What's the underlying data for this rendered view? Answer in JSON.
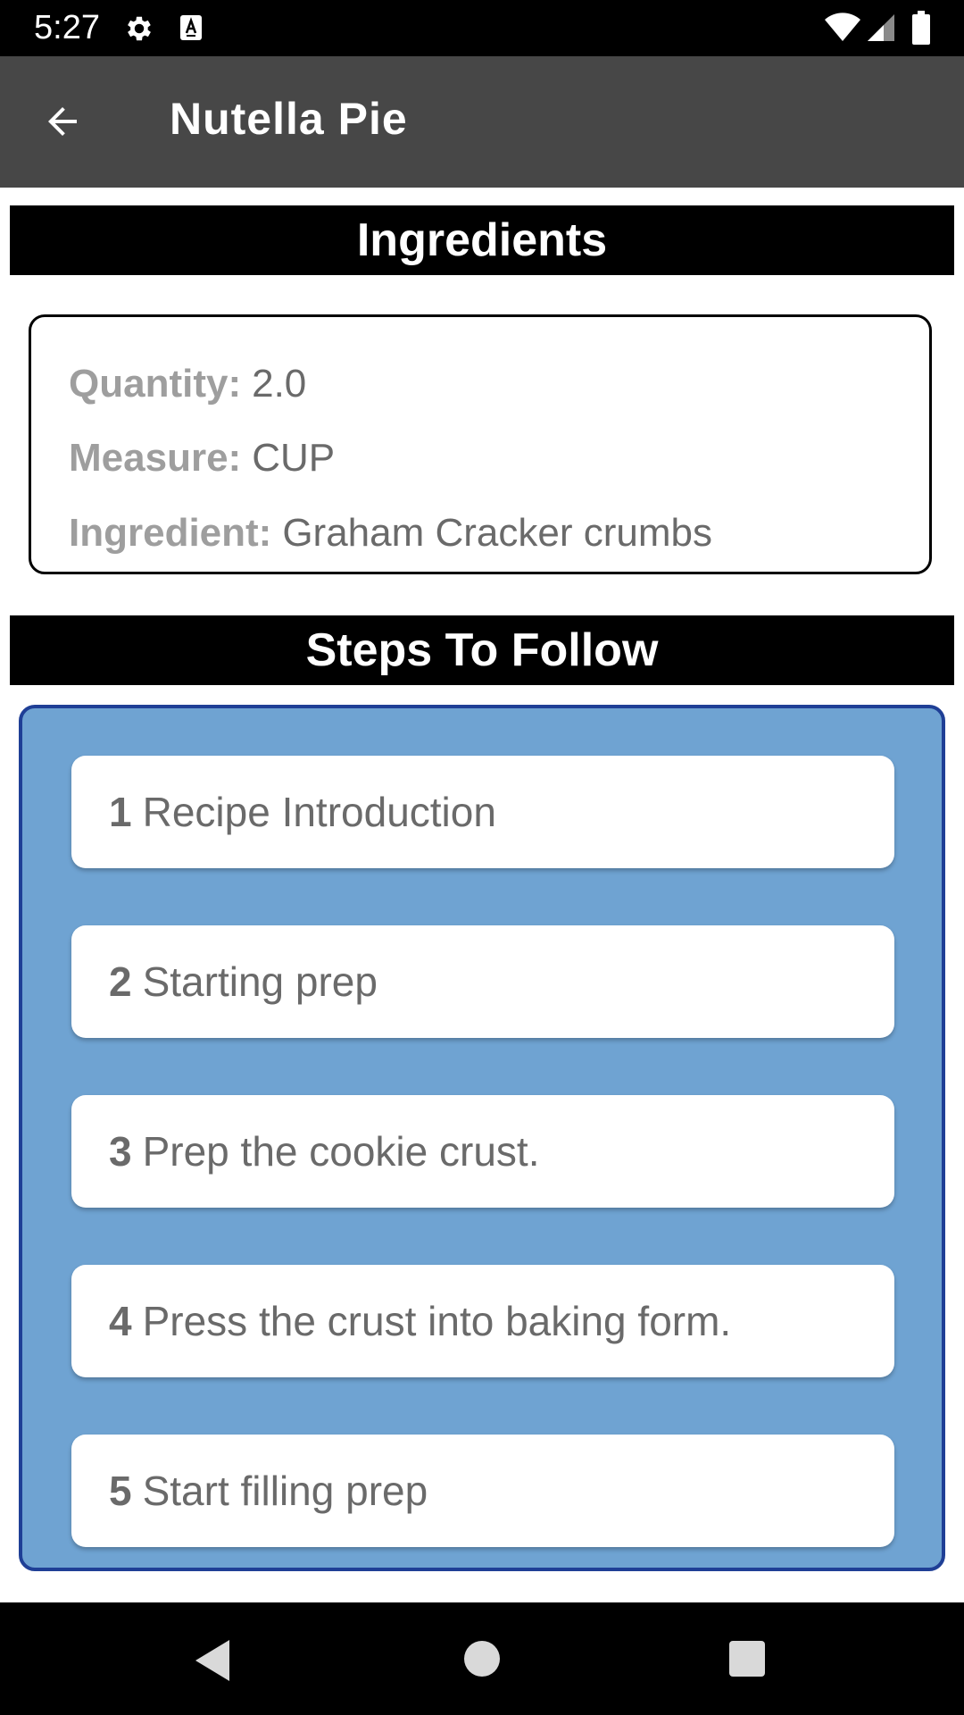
{
  "status_bar": {
    "time": "5:27",
    "icons": [
      "gear-icon",
      "a-text-icon",
      "wifi-icon",
      "signal-icon",
      "battery-icon"
    ]
  },
  "app_bar": {
    "title": "Nutella Pie",
    "back_icon": "arrow-left-icon"
  },
  "ingredients": {
    "header": "Ingredients",
    "items": [
      {
        "quantity_label": "Quantity:",
        "quantity": "2.0",
        "measure_label": "Measure:",
        "measure": "CUP",
        "ingredient_label": "Ingredient:",
        "ingredient": "Graham Cracker crumbs"
      }
    ]
  },
  "steps": {
    "header": "Steps To Follow",
    "items": [
      {
        "number": "1",
        "text": "Recipe Introduction"
      },
      {
        "number": "2",
        "text": "Starting prep"
      },
      {
        "number": "3",
        "text": "Prep the cookie crust."
      },
      {
        "number": "4",
        "text": "Press the crust into baking form."
      },
      {
        "number": "5",
        "text": "Start filling prep"
      }
    ]
  },
  "nav_bar": {
    "icons": [
      "back-triangle-icon",
      "home-circle-icon",
      "recents-square-icon"
    ]
  },
  "colors": {
    "status_bar": "#000000",
    "app_bar": "#474747",
    "section_header": "#000000",
    "steps_panel": "#6fa3d2",
    "steps_panel_border": "#1f3f96",
    "label_gray": "#9e9e9e",
    "value_gray": "#6a6a6a"
  }
}
